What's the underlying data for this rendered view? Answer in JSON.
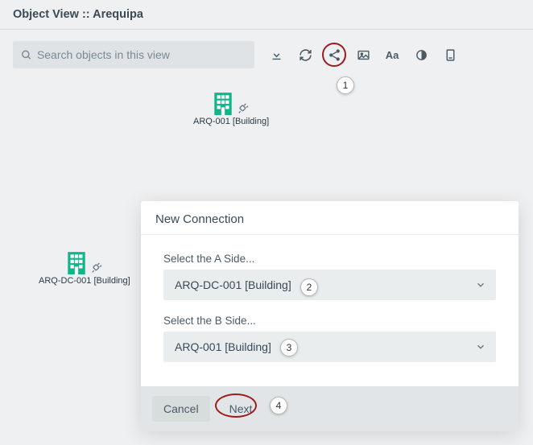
{
  "header": {
    "title": "Object View :: Arequipa"
  },
  "search": {
    "placeholder": "Search objects in this view"
  },
  "callouts": {
    "c1": "1",
    "c2": "2",
    "c3": "3",
    "c4": "4"
  },
  "nodes": {
    "n1": {
      "label": "ARQ-001 [Building]"
    },
    "n2": {
      "label": "ARQ-DC-001 [Building]"
    }
  },
  "modal": {
    "title": "New Connection",
    "labelA": "Select the A Side...",
    "valueA": "ARQ-DC-001 [Building]",
    "labelB": "Select the B Side...",
    "valueB": "ARQ-001 [Building]",
    "cancel": "Cancel",
    "next": "Next"
  }
}
